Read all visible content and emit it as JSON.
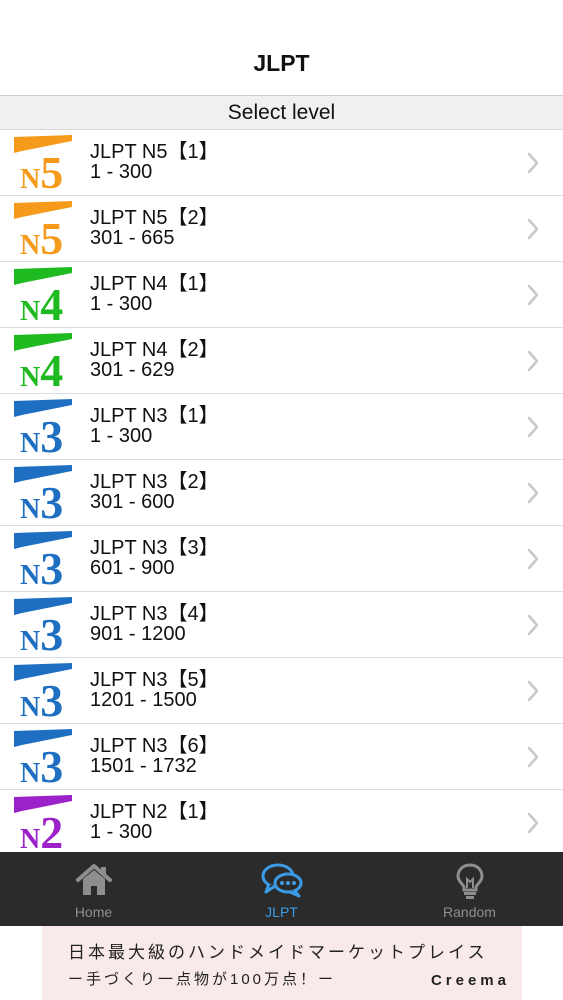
{
  "nav": {
    "title": "JLPT"
  },
  "section": {
    "header": "Select level"
  },
  "levels": {
    "N5": {
      "label": "N5",
      "color": "#f59a1b"
    },
    "N4": {
      "label": "N4",
      "color": "#1fba1f"
    },
    "N3": {
      "label": "N3",
      "color": "#1e6fc2"
    },
    "N2": {
      "label": "N2",
      "color": "#9a22c8"
    }
  },
  "rows": [
    {
      "level": "N5",
      "title": "JLPT N5【1】",
      "range": "1 - 300"
    },
    {
      "level": "N5",
      "title": "JLPT N5【2】",
      "range": "301 - 665"
    },
    {
      "level": "N4",
      "title": "JLPT N4【1】",
      "range": "1 - 300"
    },
    {
      "level": "N4",
      "title": "JLPT N4【2】",
      "range": "301 - 629"
    },
    {
      "level": "N3",
      "title": "JLPT N3【1】",
      "range": "1 - 300"
    },
    {
      "level": "N3",
      "title": "JLPT N3【2】",
      "range": "301 - 600"
    },
    {
      "level": "N3",
      "title": "JLPT N3【3】",
      "range": "601 - 900"
    },
    {
      "level": "N3",
      "title": "JLPT N3【4】",
      "range": "901 - 1200"
    },
    {
      "level": "N3",
      "title": "JLPT N3【5】",
      "range": "1201 - 1500"
    },
    {
      "level": "N3",
      "title": "JLPT N3【6】",
      "range": "1501 - 1732"
    },
    {
      "level": "N2",
      "title": "JLPT N2【1】",
      "range": "1 - 300"
    }
  ],
  "tabs": [
    {
      "label": "Home",
      "icon": "home-icon",
      "active": false
    },
    {
      "label": "JLPT",
      "icon": "chat-bubbles-icon",
      "active": true
    },
    {
      "label": "Random",
      "icon": "lightbulb-icon",
      "active": false
    }
  ],
  "ad": {
    "line1": "日本最大級のハンドメイドマーケットプレイス",
    "line2": "ー手づくり一点物が100万点！ー",
    "brand": "Creema"
  },
  "colors": {
    "tab_active": "#3b9be6",
    "tab_inactive": "#8e8e8e",
    "tab_bar_bg": "#2b2b2b",
    "ad_bg": "#f9eaea"
  }
}
